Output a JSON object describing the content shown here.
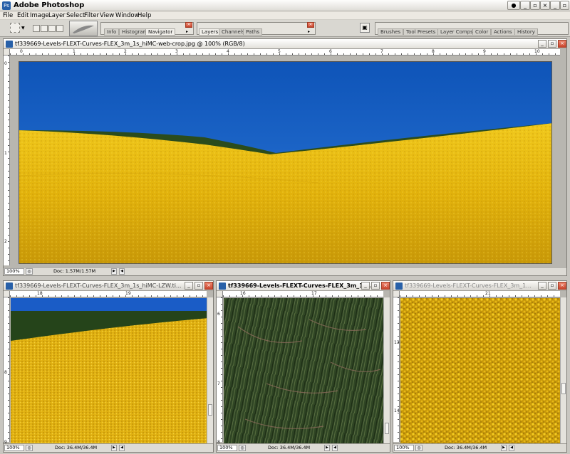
{
  "app": {
    "title": "Adobe Photoshop"
  },
  "menu": [
    "File",
    "Edit",
    "Image",
    "Layer",
    "Select",
    "Filter",
    "View",
    "Window",
    "Help"
  ],
  "palette_well": {
    "group1": [
      "Info",
      "Histogram",
      "Navigator"
    ],
    "group2": [
      "Layers",
      "Channels",
      "Paths"
    ],
    "group3": [
      "Brushes",
      "Tool Presets",
      "Layer Comps",
      "Color",
      "Actions",
      "History"
    ]
  },
  "main_doc": {
    "title": "tf339669-Levels-FLEXT-Curves-FLEX_3m_1s_hiMC-web-crop.jpg @ 100% (RGB/8)",
    "zoom": "100%",
    "doc_size": "Doc: 1.57M/1.57M",
    "ruler_h": [
      "0",
      "1",
      "2",
      "3",
      "4",
      "5",
      "6",
      "7",
      "8",
      "9",
      "10"
    ],
    "ruler_v": [
      "0",
      "1",
      "2"
    ]
  },
  "doc2": {
    "title": "tf339669-Levels-FLEXT-Curves-FLEX_3m_1s_hiMC-LZW.ti...",
    "zoom": "100%",
    "doc_size": "Doc: 36.4M/36.4M",
    "ruler_h": [
      "18",
      "19"
    ],
    "ruler_v": [
      "8",
      "9"
    ]
  },
  "doc3": {
    "title": "tf339669-Levels-FLEXT-Curves-FLEX_3m_1s...",
    "zoom": "100%",
    "doc_size": "Doc: 36.4M/36.4M",
    "ruler_h": [
      "16",
      "17"
    ],
    "ruler_v": [
      "6",
      "7",
      "8"
    ]
  },
  "doc4": {
    "title": "tf339669-Levels-FLEXT-Curves-FLEX_3m_1...",
    "zoom": "100%",
    "doc_size": "Doc: 36.4M/36.4M",
    "ruler_h": [
      "21"
    ],
    "ruler_v": [
      "13",
      "14"
    ]
  },
  "colors": {
    "sky": "#1e5fc4",
    "hill": "#2d4f1e",
    "field": "#e2b40e",
    "grass": "#3a4c2a"
  }
}
